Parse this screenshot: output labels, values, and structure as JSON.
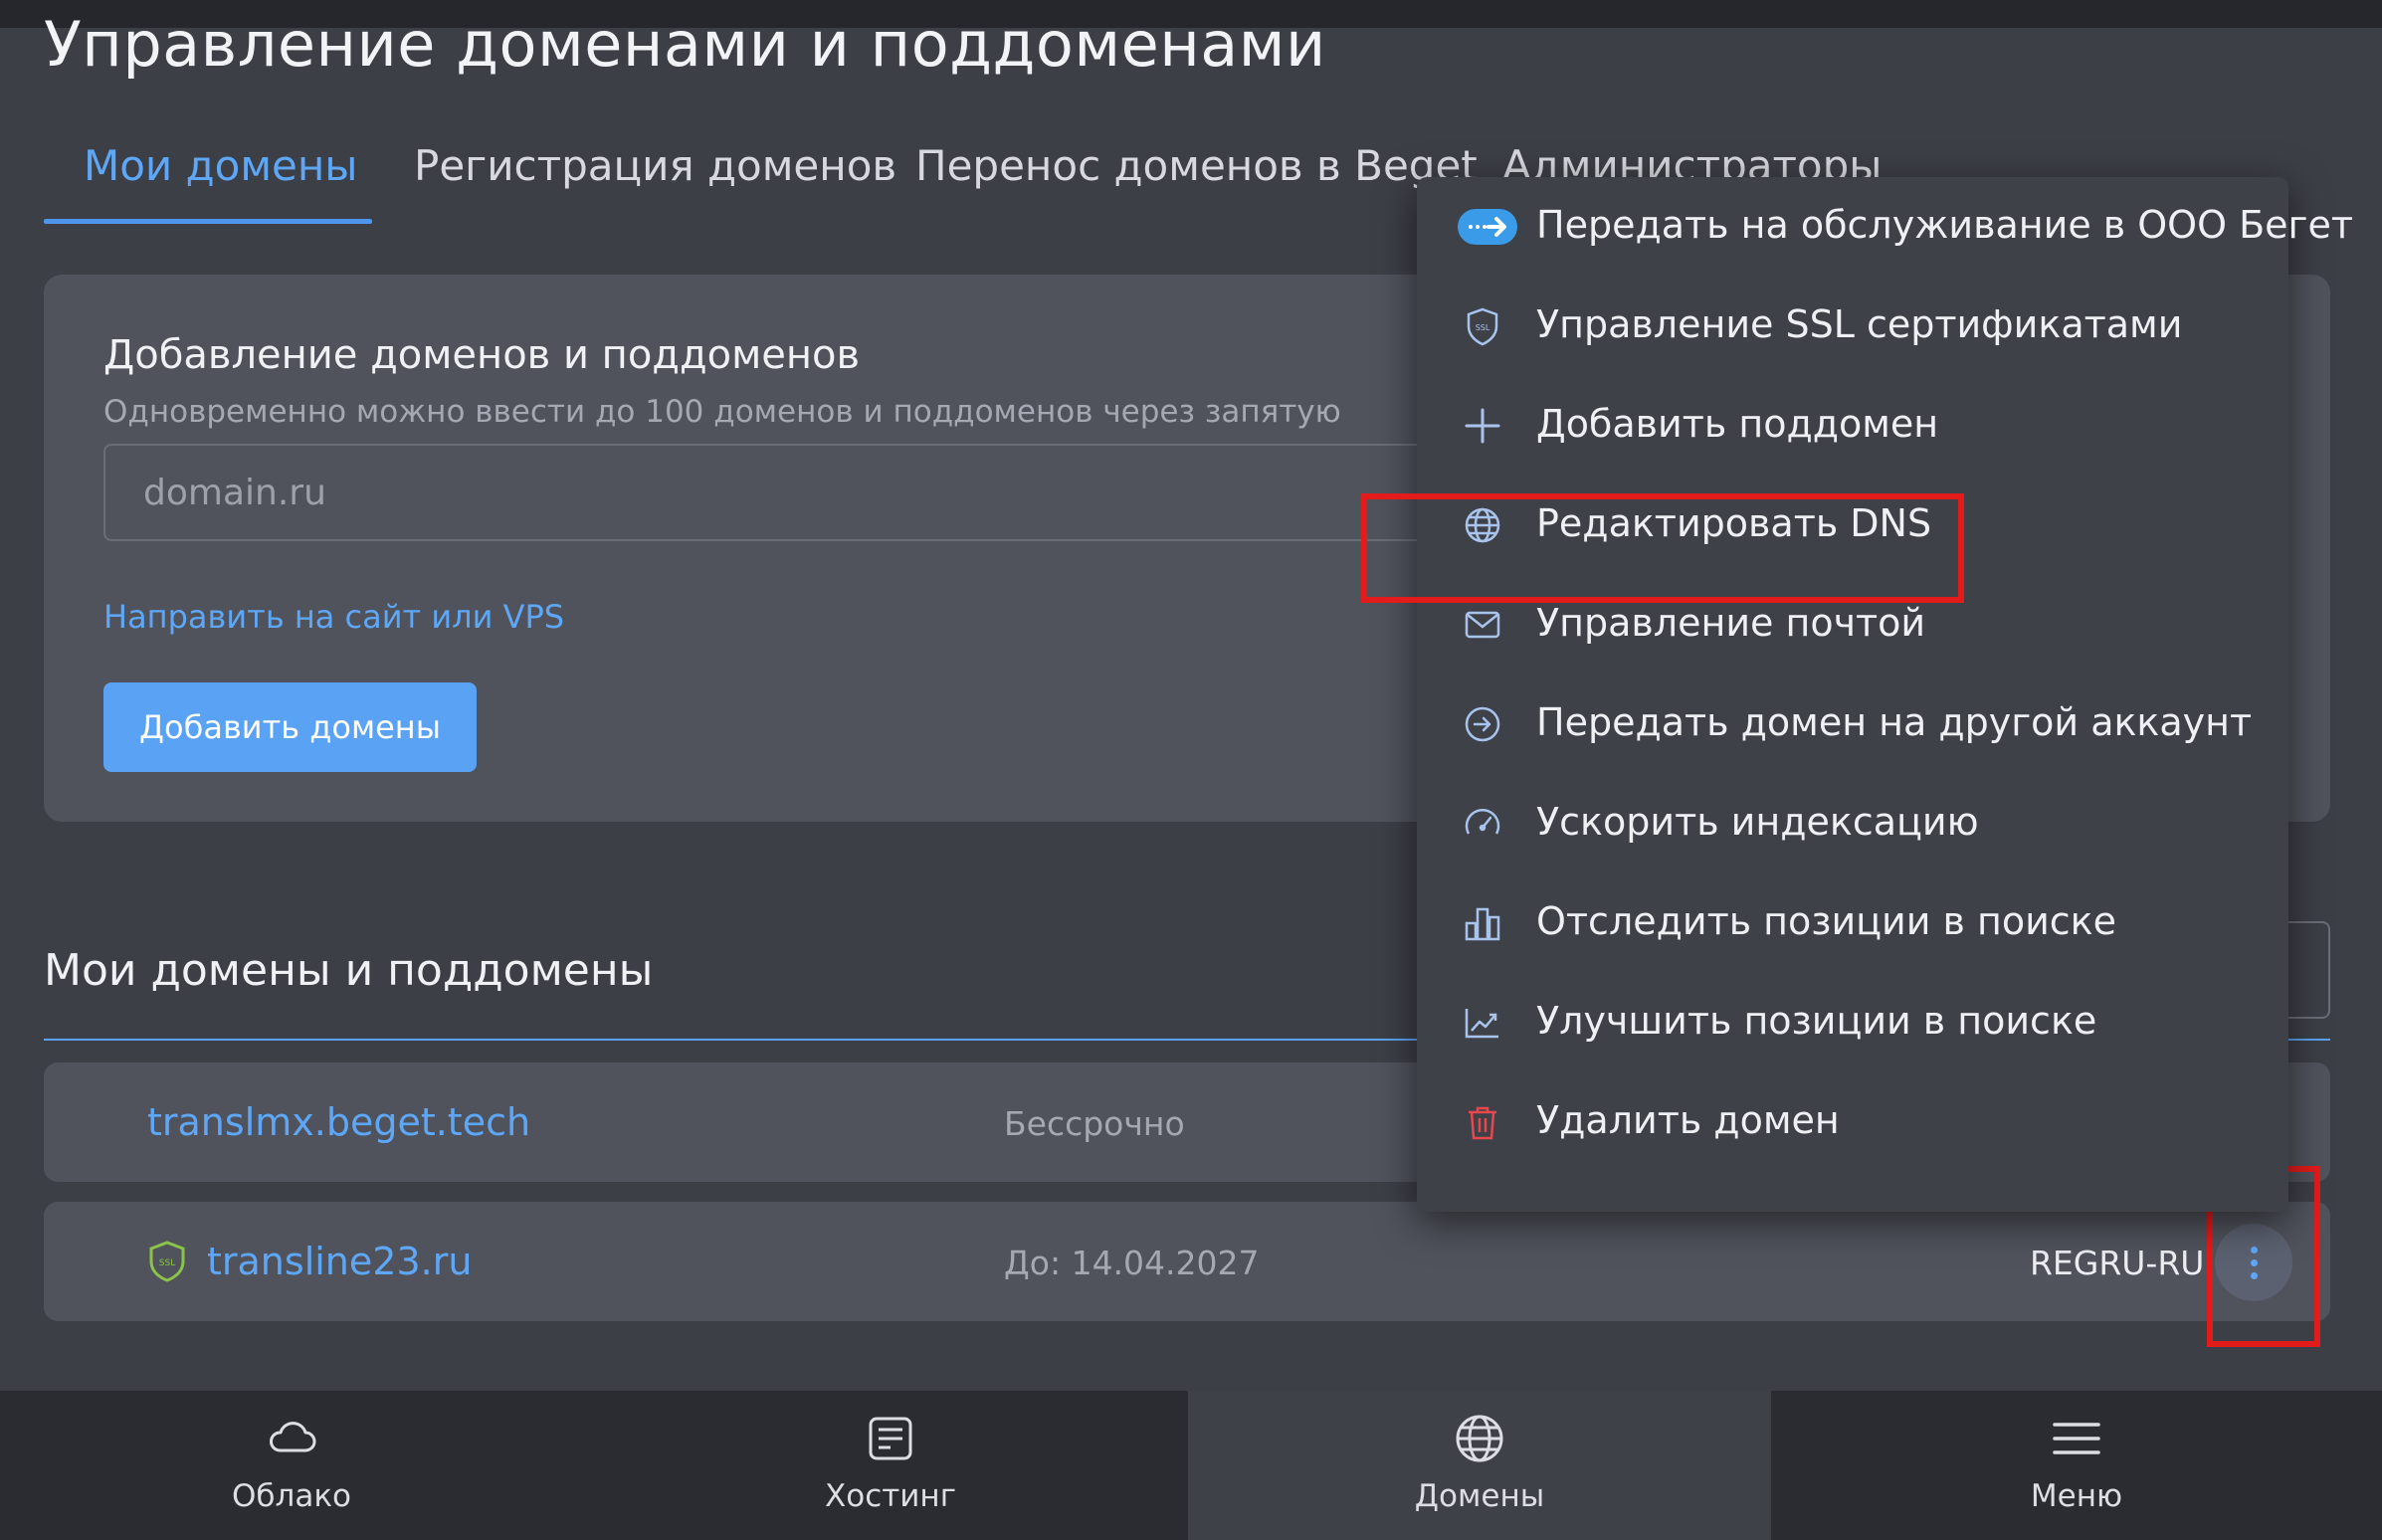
{
  "header": {
    "title": "Управление доменами и поддоменами"
  },
  "tabs": [
    {
      "label": "Мои домены",
      "active": true
    },
    {
      "label": "Регистрация доменов",
      "active": false
    },
    {
      "label": "Перенос доменов в Beget",
      "active": false
    },
    {
      "label": "Администраторы",
      "active": false
    }
  ],
  "add_section": {
    "title": "Добавление доменов и поддоменов",
    "subtitle": "Одновременно можно ввести до 100 доменов и поддоменов через запятую",
    "input_placeholder": "domain.ru",
    "input_value": "",
    "redirect_link": "Направить на сайт или VPS",
    "add_button": "Добавить домены"
  },
  "list": {
    "title": "Мои домены и поддомены",
    "rows": [
      {
        "domain": "translmx.beget.tech",
        "date": "Бессрочно",
        "registrar": "",
        "ssl": false
      },
      {
        "domain": "transline23.ru",
        "date": "До: 14.04.2027",
        "registrar": "REGRU-RU",
        "ssl": true,
        "ssl_label": "SSL"
      }
    ]
  },
  "dropdown_menu": {
    "items": [
      {
        "label": "Передать на обслуживание в ООО Бегет",
        "icon": "transfer-arrow-icon"
      },
      {
        "label": "Управление SSL сертификатами",
        "icon": "ssl-shield-icon",
        "icon_text": "SSL"
      },
      {
        "label": "Добавить поддомен",
        "icon": "plus-icon"
      },
      {
        "label": "Редактировать DNS",
        "icon": "globe-icon",
        "highlighted": true
      },
      {
        "label": "Управление почтой",
        "icon": "mail-icon"
      },
      {
        "label": "Передать домен на другой аккаунт",
        "icon": "circle-arrow-right-icon"
      },
      {
        "label": "Ускорить индексацию",
        "icon": "speedometer-icon"
      },
      {
        "label": "Отследить позиции в поиске",
        "icon": "bar-chart-icon"
      },
      {
        "label": "Улучшить позиции в поиске",
        "icon": "trend-chart-icon"
      },
      {
        "label": "Удалить домен",
        "icon": "trash-icon"
      }
    ]
  },
  "bottom_nav": [
    {
      "label": "Облако",
      "icon": "cloud-icon",
      "active": false
    },
    {
      "label": "Хостинг",
      "icon": "hosting-icon",
      "active": false
    },
    {
      "label": "Домены",
      "icon": "globe-icon",
      "active": true
    },
    {
      "label": "Меню",
      "icon": "hamburger-icon",
      "active": false
    }
  ],
  "colors": {
    "background": "#3d3f47",
    "card": "#50535c",
    "accent": "#5aa2f3",
    "link": "#5ea7f6",
    "highlight": "#e31b1b",
    "delete": "#e5484d",
    "ssl_badge": "#8bc34a"
  }
}
